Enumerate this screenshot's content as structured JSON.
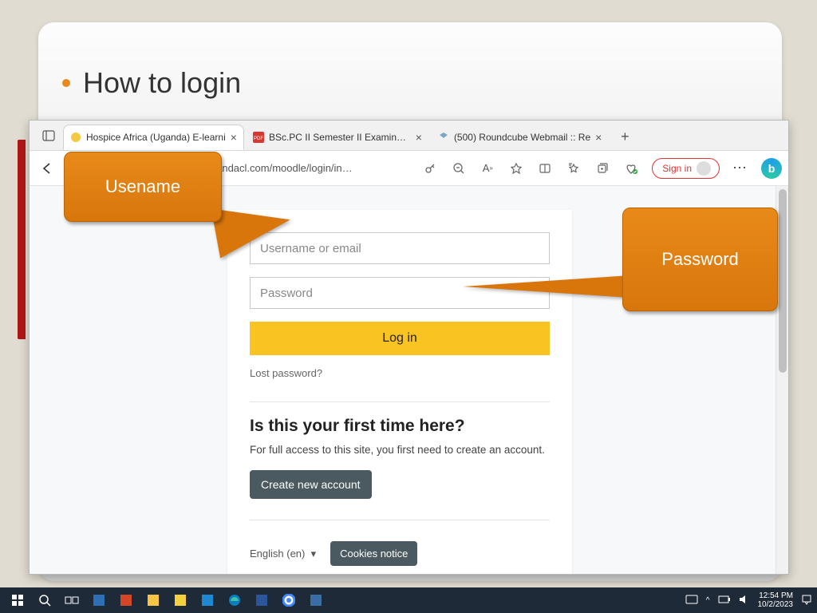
{
  "slide": {
    "title": "How to login"
  },
  "browser": {
    "tabs": [
      {
        "label": "Hospice Africa (Uganda) E-learni"
      },
      {
        "label": "BSc.PC II Semester II Examination"
      },
      {
        "label": "(500) Roundcube Webmail :: Re"
      }
    ],
    "url_fragment": "plandacl.com/moodle/login/in…",
    "signin_label": "Sign in"
  },
  "login": {
    "username_placeholder": "Username or email",
    "password_placeholder": "Password",
    "login_button": "Log in",
    "lost_password": "Lost password?",
    "first_time_heading": "Is this your first time here?",
    "first_time_desc": "For full access to this site, you first need to create an account.",
    "create_account": "Create new account",
    "language": "English (en)",
    "cookies": "Cookies notice"
  },
  "callouts": {
    "username": "Usename",
    "password": "Password"
  },
  "taskbar": {
    "time": "12:54 PM",
    "date": "10/2/2023"
  }
}
